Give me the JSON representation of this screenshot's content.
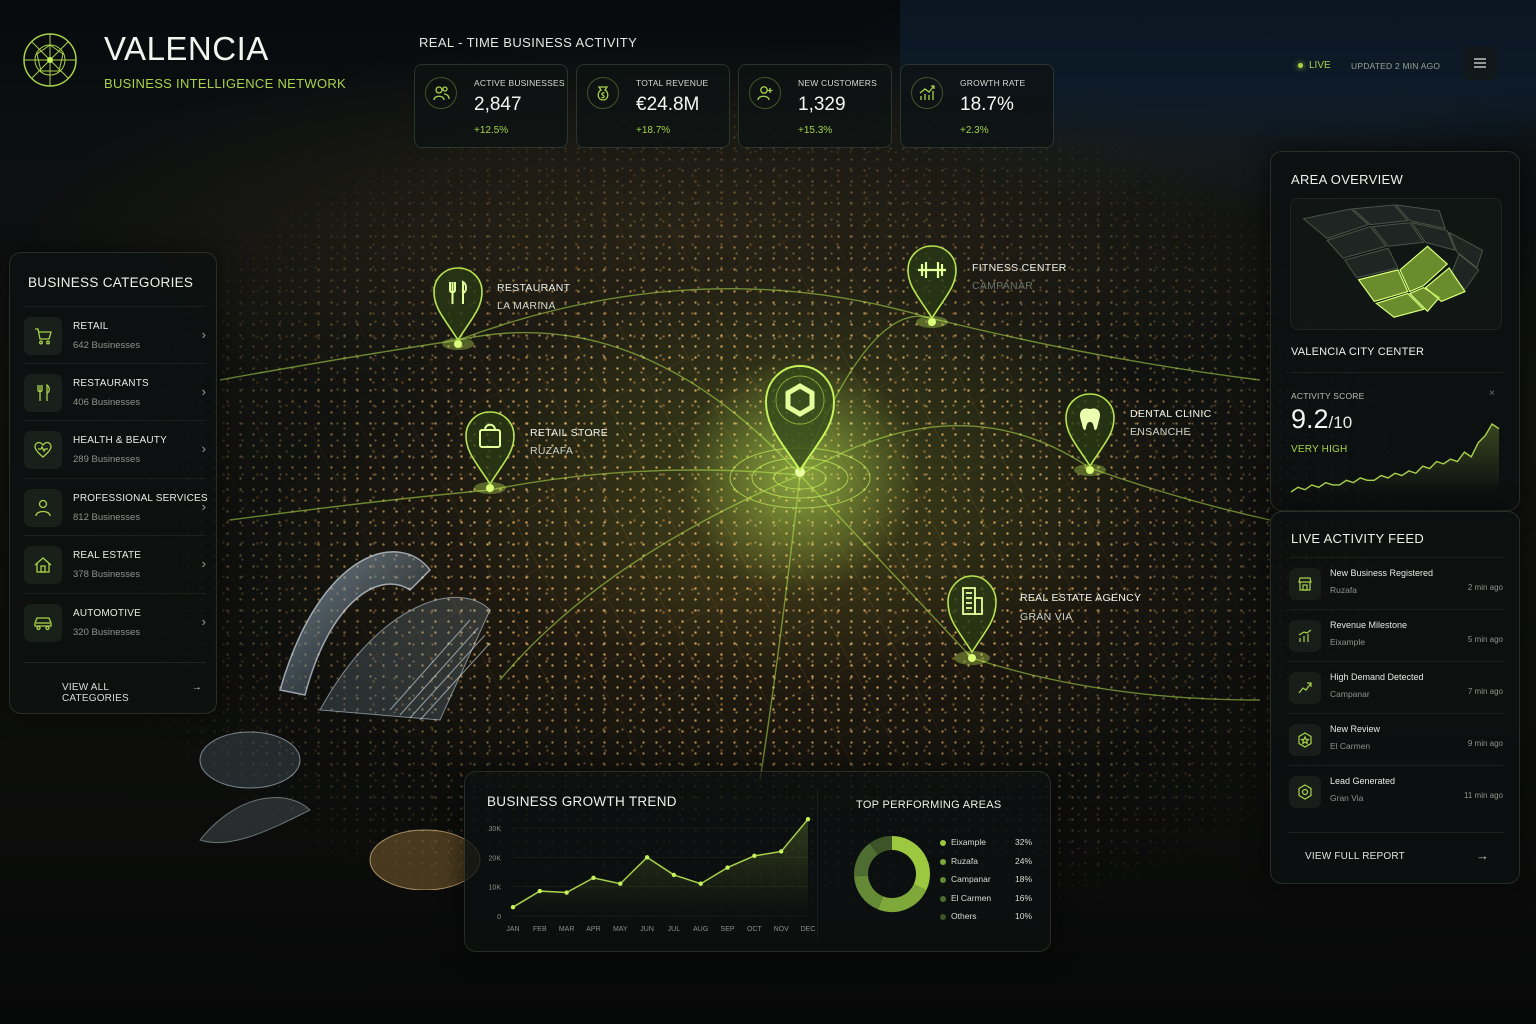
{
  "brand": {
    "name": "VALENCIA",
    "subtitle": "BUSINESS INTELLIGENCE NETWORK",
    "logo_icon": "network-globe-icon",
    "accent": "#a8d24a"
  },
  "realtime": {
    "title": "REAL - TIME BUSINESS ACTIVITY",
    "kpis": [
      {
        "label": "ACTIVE BUSINESSES",
        "value": "2,847",
        "delta": "+12.5%",
        "icon": "businesses-icon"
      },
      {
        "label": "TOTAL REVENUE",
        "value": "€24.8M",
        "delta": "+18.7%",
        "icon": "revenue-icon"
      },
      {
        "label": "NEW CUSTOMERS",
        "value": "1,329",
        "delta": "+15.3%",
        "icon": "customers-icon"
      },
      {
        "label": "GROWTH RATE",
        "value": "18.7%",
        "delta": "+2.3%",
        "icon": "growth-icon"
      }
    ]
  },
  "status": {
    "live_label": "LIVE",
    "updated": "UPDATED 2 MIN AGO"
  },
  "categories": {
    "title": "BUSINESS CATEGORIES",
    "items": [
      {
        "name": "RETAIL",
        "count": "642 Businesses",
        "icon": "cart-icon"
      },
      {
        "name": "RESTAURANTS",
        "count": "406 Businesses",
        "icon": "fork-knife-icon"
      },
      {
        "name": "HEALTH & BEAUTY",
        "count": "289 Businesses",
        "icon": "heart-icon"
      },
      {
        "name": "PROFESSIONAL SERVICES",
        "count": "812 Businesses",
        "icon": "person-icon"
      },
      {
        "name": "REAL ESTATE",
        "count": "378 Businesses",
        "icon": "house-icon"
      },
      {
        "name": "AUTOMOTIVE",
        "count": "320 Businesses",
        "icon": "car-icon"
      }
    ],
    "view_all": "VIEW ALL CATEGORIES"
  },
  "map_pins": [
    {
      "title": "RESTAURANT",
      "area": "LA MARINA",
      "icon": "fork-knife-icon"
    },
    {
      "title": "FITNESS CENTER",
      "area": "CAMPANAR",
      "icon": "dumbbell-icon"
    },
    {
      "title": "RETAIL STORE",
      "area": "RUZAFA",
      "icon": "shopping-bag-icon"
    },
    {
      "title": "DENTAL CLINIC",
      "area": "ENSANCHE",
      "icon": "tooth-icon"
    },
    {
      "title": "REAL ESTATE AGENCY",
      "area": "GRAN VIA",
      "icon": "building-icon"
    }
  ],
  "area_overview": {
    "title": "AREA OVERVIEW",
    "location": "VALENCIA CITY CENTER",
    "score_label": "ACTIVITY SCORE",
    "score": "9.2",
    "score_of": "/10",
    "level": "VERY HIGH"
  },
  "feed": {
    "title": "LIVE ACTIVITY FEED",
    "items": [
      {
        "title": "New Business Registered",
        "place": "Ruzafa",
        "time": "2 min ago",
        "icon": "store-icon"
      },
      {
        "title": "Revenue Milestone",
        "place": "Eixample",
        "time": "5 min ago",
        "icon": "bar-chart-icon"
      },
      {
        "title": "High Demand Detected",
        "place": "Campanar",
        "time": "7 min ago",
        "icon": "trend-up-icon"
      },
      {
        "title": "New Review",
        "place": "El Carmen",
        "time": "9 min ago",
        "icon": "star-badge-icon"
      },
      {
        "title": "Lead Generated",
        "place": "Gran Via",
        "time": "11 min ago",
        "icon": "target-icon"
      }
    ],
    "report": "VIEW FULL REPORT"
  },
  "growth": {
    "title": "BUSINESS GROWTH TREND",
    "top_title": "TOP PERFORMING AREAS"
  },
  "chart_data": [
    {
      "type": "line",
      "title": "BUSINESS GROWTH TREND",
      "categories": [
        "JAN",
        "FEB",
        "MAR",
        "APR",
        "MAY",
        "JUN",
        "JUL",
        "AUG",
        "SEP",
        "OCT",
        "NOV",
        "DEC"
      ],
      "y_ticks": [
        "0",
        "10K",
        "20K",
        "30K"
      ],
      "ylim": [
        0,
        30000
      ],
      "series": [
        {
          "values": [
            3000,
            8500,
            8000,
            13000,
            11000,
            20000,
            14000,
            11000,
            16500,
            20500,
            22000,
            33000
          ]
        }
      ]
    },
    {
      "type": "pie",
      "title": "TOP PERFORMING AREAS",
      "labels": [
        "Eixample",
        "Ruzafa",
        "Campanar",
        "El Carmen",
        "Others"
      ],
      "values": [
        32,
        24,
        18,
        16,
        10
      ],
      "value_labels": [
        "32%",
        "24%",
        "18%",
        "16%",
        "10%"
      ],
      "colors": [
        "#9cc83f",
        "#7fa83a",
        "#658a36",
        "#4f6d30",
        "#3d5429"
      ]
    },
    {
      "type": "line",
      "title": "ACTIVITY SCORE",
      "series": [
        {
          "values": [
            1,
            3,
            2,
            4,
            3,
            5,
            4,
            4,
            6,
            5,
            7,
            6,
            6,
            8,
            7,
            9,
            8,
            10,
            9,
            12,
            11,
            14,
            13,
            15,
            14,
            18,
            16,
            22,
            25,
            30,
            28
          ]
        }
      ]
    }
  ]
}
